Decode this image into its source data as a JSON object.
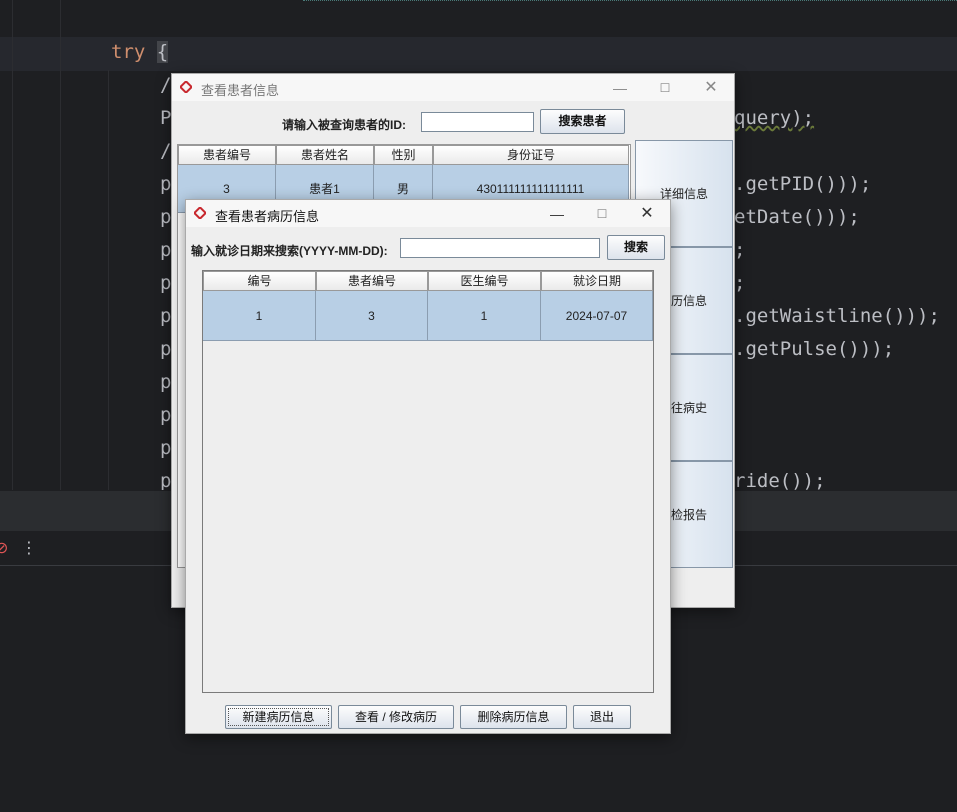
{
  "ide": {
    "code_lines": [
      {
        "text_prefix": "try ",
        "text_brace": "{"
      },
      {
        "text": "/"
      },
      {
        "text": "P",
        "tail": "query);"
      },
      {
        "text": "/"
      },
      {
        "text": "p",
        "tail": ".getPID()));"
      },
      {
        "text": "p",
        "tail": "etDate()));"
      },
      {
        "text": "p",
        "tail": ";"
      },
      {
        "text": "p",
        "tail": ";"
      },
      {
        "text": "p",
        "tail": ".getWaistline()));"
      },
      {
        "text": "p",
        "tail": ".getPulse()));"
      },
      {
        "text": "p"
      },
      {
        "text": "p"
      },
      {
        "text": "p"
      },
      {
        "text": "p",
        "tail": "ride());"
      }
    ],
    "toolbar_icons": [
      "no-entry-icon",
      "more-vertical-icon"
    ],
    "toolbar_glyphs": {
      "no_entry": "⊘",
      "more": "⋮"
    }
  },
  "back_window": {
    "title": "查看患者信息",
    "controls": {
      "minimize": "—",
      "maximize": "☐",
      "close": "✕"
    },
    "search_label": "请输入被查询患者的ID:",
    "search_value": "",
    "search_button": "搜索患者",
    "table": {
      "headers": [
        "患者编号",
        "患者姓名",
        "性别",
        "身份证号"
      ],
      "rows": [
        [
          "3",
          "患者1",
          "男",
          "430111111111111111"
        ]
      ]
    },
    "side_buttons": [
      "详细信息",
      "历信息",
      "往病史",
      "检报告"
    ]
  },
  "front_window": {
    "title": "查看患者病历信息",
    "controls": {
      "minimize": "—",
      "maximize": "☐",
      "close": "✕"
    },
    "search_label": "输入就诊日期来搜索(YYYY-MM-DD):",
    "search_value": "",
    "search_button": "搜索",
    "table": {
      "headers": [
        "编号",
        "患者编号",
        "医生编号",
        "就诊日期"
      ],
      "rows": [
        [
          "1",
          "3",
          "1",
          "2024-07-07"
        ]
      ]
    },
    "buttons": {
      "new": "新建病历信息",
      "view_edit": "查看 / 修改病历",
      "delete": "删除病历信息",
      "exit": "退出"
    }
  },
  "colors": {
    "ide_bg": "#1e1f22",
    "keyword": "#cf8e6d",
    "selection_blue": "#b8cfe5",
    "app_icon_red": "#c8282e"
  }
}
